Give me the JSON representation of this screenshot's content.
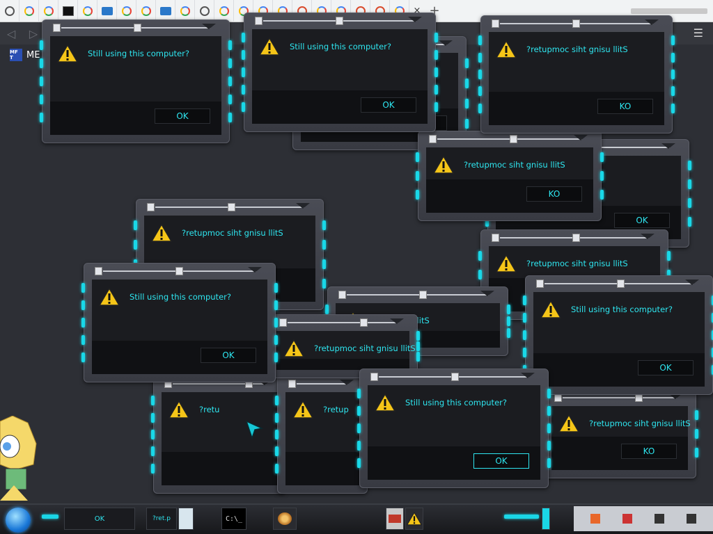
{
  "browser": {
    "tab_close": "×",
    "tab_add": "+",
    "back": "◁",
    "forward": "▷",
    "menu": "☰",
    "bookmark_icon_text": "MF T",
    "bookmark_label": "ME"
  },
  "dialog": {
    "message": "Still using this computer?",
    "message_reversed": "?retupmoc siht gnisu llitS",
    "ok": "OK",
    "ok_reversed": "KO",
    "partial_1": "siht gnisu llitS",
    "partial_2": "computer?",
    "partial_3": "?retu",
    "partial_4": "?retup"
  },
  "taskbar": {
    "ok_fragment": "OK",
    "shell_text": "C:\\_",
    "ret_fragment": "?ret.p"
  },
  "colors": {
    "accent": "#2ee6f0",
    "led": "#19d8e8",
    "desktop": "#2d2f35"
  }
}
